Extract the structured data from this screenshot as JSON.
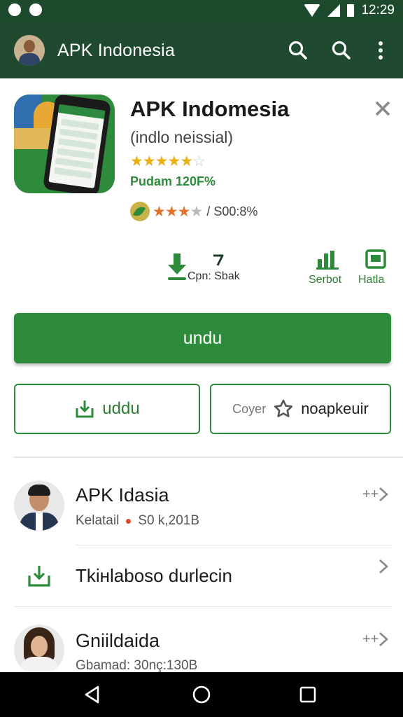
{
  "status_bar": {
    "time": "12:29"
  },
  "app_bar": {
    "title": "APK Indonesia"
  },
  "app": {
    "name": "APK Indomesia",
    "subtitle": "(indlo neissial)",
    "stars_filled": "★★★★",
    "stars_half": "★",
    "stars_empty": "☆",
    "price": "Pudam 120F%",
    "rating2_filled": "★★★",
    "rating2_empty": "★",
    "rating2_text": "/ S00:8%"
  },
  "actions": {
    "open_label": "Cpn: Sbak",
    "chart_label": "Serbot",
    "doc_label": "Hatla"
  },
  "buttons": {
    "primary": "undu",
    "left_outline": "uddu",
    "right_outline_sub": "Coyer",
    "right_outline": "noapkeuir"
  },
  "list": [
    {
      "title": "APK Idasia",
      "sub_left": "Kelatail",
      "sub_right": "S0 k,201B",
      "trailing": "++"
    },
    {
      "title": "Tkiнlaboso durlecin"
    },
    {
      "title": "Gniildaida",
      "sub": "Gbamad: 30nç:130B",
      "trailing": "++"
    }
  ],
  "colors": {
    "brand": "#2e8b3c",
    "app_bar": "#1f4a30",
    "status_bar": "#1d4a2c"
  }
}
